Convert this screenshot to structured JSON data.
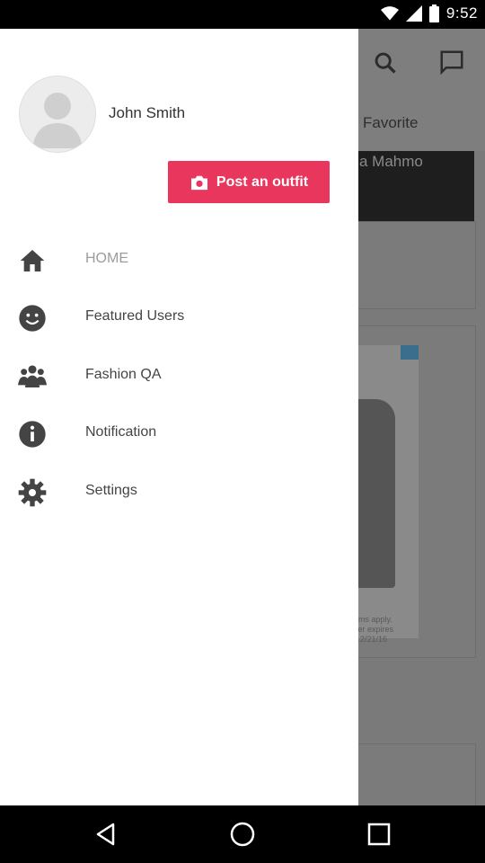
{
  "status_bar": {
    "time": "9:52"
  },
  "background": {
    "tab_favorite": "Favorite",
    "card_text": "a Mahmo",
    "ad_fine_print": "rms apply.\nter expires\n12/21/16"
  },
  "drawer": {
    "user_name": "John Smith",
    "post_button_label": "Post an outfit",
    "menu": [
      {
        "label": "HOME",
        "icon": "home-icon"
      },
      {
        "label": "Featured Users",
        "icon": "smiley-icon"
      },
      {
        "label": "Fashion QA",
        "icon": "people-icon"
      },
      {
        "label": "Notification",
        "icon": "info-icon"
      },
      {
        "label": "Settings",
        "icon": "gear-icon"
      }
    ]
  },
  "colors": {
    "accent": "#e8365d",
    "icon": "#444444",
    "home_text": "#9c9c9c"
  }
}
